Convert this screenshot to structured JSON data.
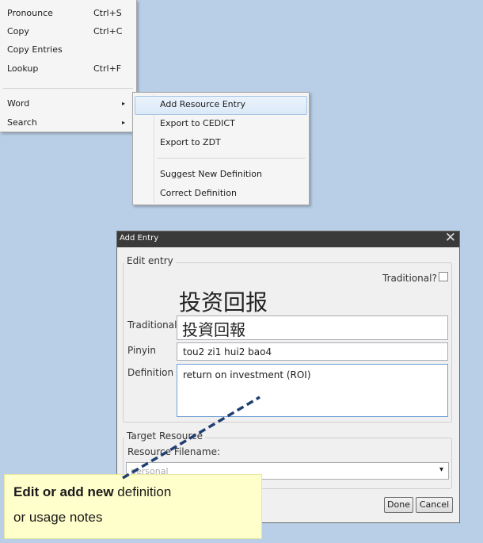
{
  "context_menu": {
    "items": [
      {
        "label": "Pronounce",
        "shortcut": "Ctrl+S"
      },
      {
        "label": "Copy",
        "shortcut": "Ctrl+C"
      },
      {
        "label": "Copy Entries",
        "shortcut": ""
      },
      {
        "label": "Lookup",
        "shortcut": "Ctrl+F"
      },
      {
        "label": "Word",
        "shortcut": ""
      },
      {
        "label": "Search",
        "shortcut": ""
      }
    ],
    "submenu_arrow": "▸"
  },
  "submenu": {
    "items": [
      {
        "label": "Add Resource Entry"
      },
      {
        "label": "Export to CEDICT"
      },
      {
        "label": "Export to ZDT"
      },
      {
        "label": "Suggest New Definition"
      },
      {
        "label": "Correct Definition"
      }
    ]
  },
  "dialog": {
    "title": "Add Entry",
    "close_glyph": "✕",
    "edit_entry_legend": "Edit entry",
    "traditional_check_label": "Traditional?",
    "traditional_checked": false,
    "simplified_display": "投资回报",
    "traditional_label": "Traditional",
    "traditional_value": "投資回報",
    "pinyin_label": "Pinyin",
    "pinyin_value": "tou2 zi1 hui2 bao4",
    "definition_label": "Definition",
    "definition_value": "return on investment (ROI)",
    "target_legend": "Target Resource",
    "resource_filename_label": "Resource Filename:",
    "resource_filename_value": "personal",
    "dropdown_arrow": "▾",
    "done_label": "Done",
    "cancel_label": "Cancel"
  },
  "callout": {
    "bold_text": "Edit or add new",
    "text": " definition",
    "line2": "or usage notes"
  },
  "colors": {
    "background": "#b9cfe7",
    "arrow": "#1f3f73",
    "callout": "#ffffcc"
  }
}
